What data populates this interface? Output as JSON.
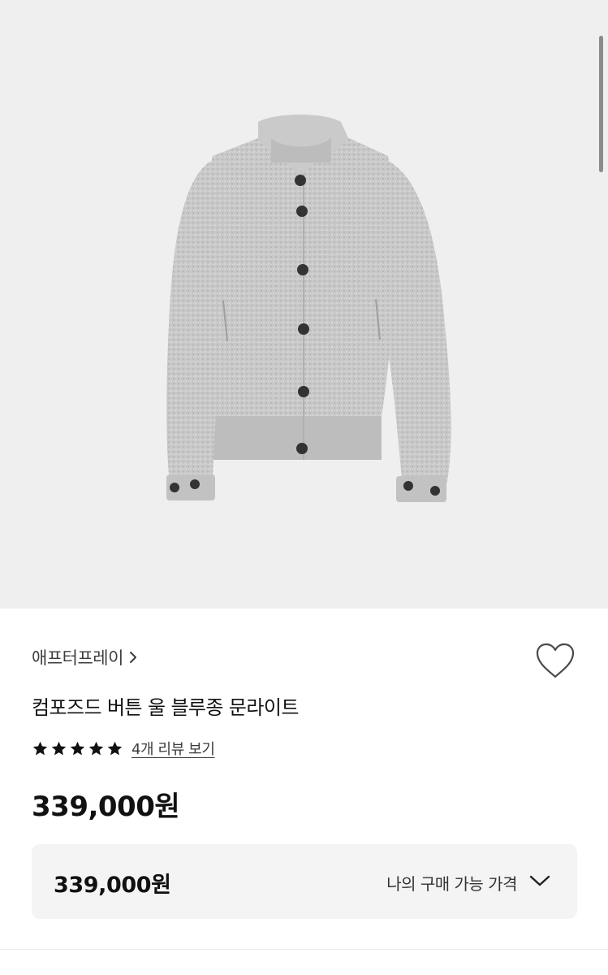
{
  "product_image": {
    "alt": "gray wool bomber jacket"
  },
  "brand": {
    "name": "애프터프레이"
  },
  "product": {
    "title": "컴포즈드 버튼 울 블루종 문라이트"
  },
  "rating": {
    "stars": 5,
    "review_link": "4개 리뷰 보기"
  },
  "price": {
    "display": "339,000원"
  },
  "purchase_price": {
    "amount": "339,000원",
    "label": "나의 구매 가능 가격"
  },
  "colors": {
    "hero_bg": "#efefef",
    "box_bg": "#f4f4f4",
    "text": "#111111"
  }
}
